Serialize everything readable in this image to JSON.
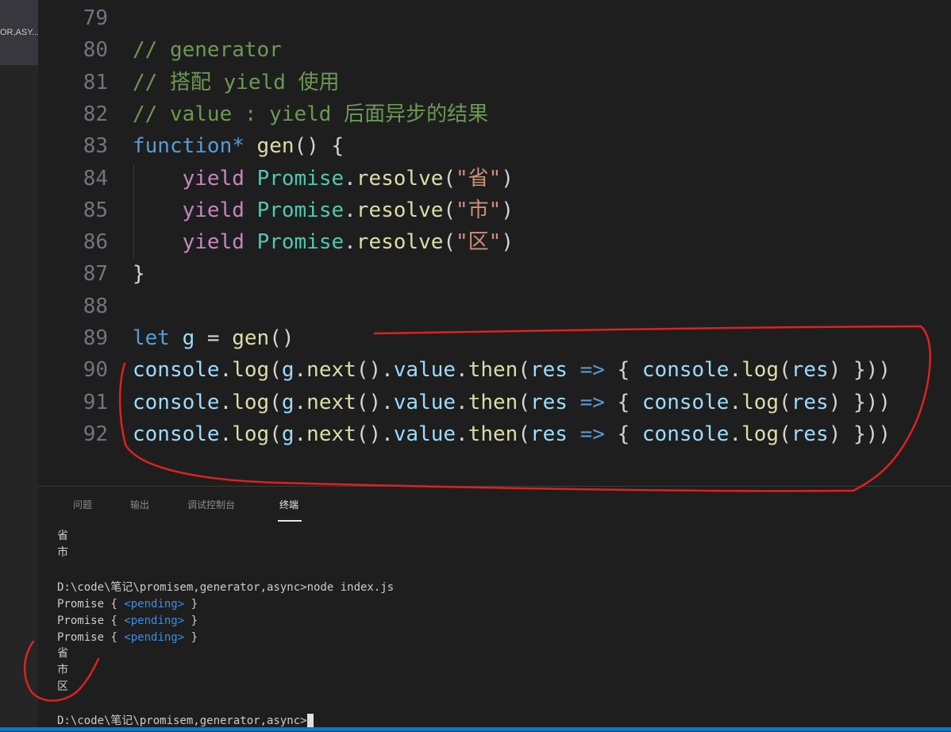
{
  "sidebar": {
    "tab_label": "OR,ASY..."
  },
  "editor": {
    "lines": [
      {
        "num": "79",
        "tokens": []
      },
      {
        "num": "80",
        "tokens": [
          {
            "t": "// generator",
            "c": "cm"
          }
        ]
      },
      {
        "num": "81",
        "tokens": [
          {
            "t": "// 搭配 yield 使用",
            "c": "cm"
          }
        ]
      },
      {
        "num": "82",
        "tokens": [
          {
            "t": "// value : yield 后面异步的结果",
            "c": "cm"
          }
        ]
      },
      {
        "num": "83",
        "tokens": [
          {
            "t": "function*",
            "c": "kw"
          },
          {
            "t": " ",
            "c": "pun"
          },
          {
            "t": "gen",
            "c": "fn"
          },
          {
            "t": "() {",
            "c": "pun"
          }
        ]
      },
      {
        "num": "84",
        "tokens": [
          {
            "t": "    ",
            "c": "pun"
          },
          {
            "t": "yield",
            "c": "yk"
          },
          {
            "t": " ",
            "c": "pun"
          },
          {
            "t": "Promise",
            "c": "cls"
          },
          {
            "t": ".",
            "c": "pun"
          },
          {
            "t": "resolve",
            "c": "fn"
          },
          {
            "t": "(",
            "c": "pun"
          },
          {
            "t": "\"省\"",
            "c": "str"
          },
          {
            "t": ")",
            "c": "pun"
          }
        ]
      },
      {
        "num": "85",
        "tokens": [
          {
            "t": "    ",
            "c": "pun"
          },
          {
            "t": "yield",
            "c": "yk"
          },
          {
            "t": " ",
            "c": "pun"
          },
          {
            "t": "Promise",
            "c": "cls"
          },
          {
            "t": ".",
            "c": "pun"
          },
          {
            "t": "resolve",
            "c": "fn"
          },
          {
            "t": "(",
            "c": "pun"
          },
          {
            "t": "\"市\"",
            "c": "str"
          },
          {
            "t": ")",
            "c": "pun"
          }
        ]
      },
      {
        "num": "86",
        "tokens": [
          {
            "t": "    ",
            "c": "pun"
          },
          {
            "t": "yield",
            "c": "yk"
          },
          {
            "t": " ",
            "c": "pun"
          },
          {
            "t": "Promise",
            "c": "cls"
          },
          {
            "t": ".",
            "c": "pun"
          },
          {
            "t": "resolve",
            "c": "fn"
          },
          {
            "t": "(",
            "c": "pun"
          },
          {
            "t": "\"区\"",
            "c": "str"
          },
          {
            "t": ")",
            "c": "pun"
          }
        ]
      },
      {
        "num": "87",
        "tokens": [
          {
            "t": "}",
            "c": "pun"
          }
        ]
      },
      {
        "num": "88",
        "tokens": []
      },
      {
        "num": "89",
        "tokens": [
          {
            "t": "let",
            "c": "kw"
          },
          {
            "t": " ",
            "c": "pun"
          },
          {
            "t": "g",
            "c": "var"
          },
          {
            "t": " = ",
            "c": "pun"
          },
          {
            "t": "gen",
            "c": "fn"
          },
          {
            "t": "()",
            "c": "pun"
          }
        ]
      },
      {
        "num": "90",
        "tokens": [
          {
            "t": "console",
            "c": "var"
          },
          {
            "t": ".",
            "c": "pun"
          },
          {
            "t": "log",
            "c": "fn"
          },
          {
            "t": "(",
            "c": "pun"
          },
          {
            "t": "g",
            "c": "var"
          },
          {
            "t": ".",
            "c": "pun"
          },
          {
            "t": "next",
            "c": "fn"
          },
          {
            "t": "().",
            "c": "pun"
          },
          {
            "t": "value",
            "c": "var"
          },
          {
            "t": ".",
            "c": "pun"
          },
          {
            "t": "then",
            "c": "fn"
          },
          {
            "t": "(",
            "c": "pun"
          },
          {
            "t": "res",
            "c": "var"
          },
          {
            "t": " ",
            "c": "pun"
          },
          {
            "t": "=>",
            "c": "kw"
          },
          {
            "t": " { ",
            "c": "pun"
          },
          {
            "t": "console",
            "c": "var"
          },
          {
            "t": ".",
            "c": "pun"
          },
          {
            "t": "log",
            "c": "fn"
          },
          {
            "t": "(",
            "c": "pun"
          },
          {
            "t": "res",
            "c": "var"
          },
          {
            "t": ") }))",
            "c": "pun"
          }
        ]
      },
      {
        "num": "91",
        "tokens": [
          {
            "t": "console",
            "c": "var"
          },
          {
            "t": ".",
            "c": "pun"
          },
          {
            "t": "log",
            "c": "fn"
          },
          {
            "t": "(",
            "c": "pun"
          },
          {
            "t": "g",
            "c": "var"
          },
          {
            "t": ".",
            "c": "pun"
          },
          {
            "t": "next",
            "c": "fn"
          },
          {
            "t": "().",
            "c": "pun"
          },
          {
            "t": "value",
            "c": "var"
          },
          {
            "t": ".",
            "c": "pun"
          },
          {
            "t": "then",
            "c": "fn"
          },
          {
            "t": "(",
            "c": "pun"
          },
          {
            "t": "res",
            "c": "var"
          },
          {
            "t": " ",
            "c": "pun"
          },
          {
            "t": "=>",
            "c": "kw"
          },
          {
            "t": " { ",
            "c": "pun"
          },
          {
            "t": "console",
            "c": "var"
          },
          {
            "t": ".",
            "c": "pun"
          },
          {
            "t": "log",
            "c": "fn"
          },
          {
            "t": "(",
            "c": "pun"
          },
          {
            "t": "res",
            "c": "var"
          },
          {
            "t": ") }))",
            "c": "pun"
          }
        ]
      },
      {
        "num": "92",
        "tokens": [
          {
            "t": "console",
            "c": "var"
          },
          {
            "t": ".",
            "c": "pun"
          },
          {
            "t": "log",
            "c": "fn"
          },
          {
            "t": "(",
            "c": "pun"
          },
          {
            "t": "g",
            "c": "var"
          },
          {
            "t": ".",
            "c": "pun"
          },
          {
            "t": "next",
            "c": "fn"
          },
          {
            "t": "().",
            "c": "pun"
          },
          {
            "t": "value",
            "c": "var"
          },
          {
            "t": ".",
            "c": "pun"
          },
          {
            "t": "then",
            "c": "fn"
          },
          {
            "t": "(",
            "c": "pun"
          },
          {
            "t": "res",
            "c": "var"
          },
          {
            "t": " ",
            "c": "pun"
          },
          {
            "t": "=>",
            "c": "kw"
          },
          {
            "t": " { ",
            "c": "pun"
          },
          {
            "t": "console",
            "c": "var"
          },
          {
            "t": ".",
            "c": "pun"
          },
          {
            "t": "log",
            "c": "fn"
          },
          {
            "t": "(",
            "c": "pun"
          },
          {
            "t": "res",
            "c": "var"
          },
          {
            "t": ") }))",
            "c": "pun"
          }
        ]
      }
    ]
  },
  "panel": {
    "tabs": [
      {
        "label": "问题",
        "active": false
      },
      {
        "label": "输出",
        "active": false
      },
      {
        "label": "调试控制台",
        "active": false
      },
      {
        "label": "终端",
        "active": true
      }
    ],
    "terminal": {
      "out1": "省",
      "out2": "市",
      "cmd_prompt": "D:\\code\\笔记\\promisem,generator,async>",
      "cmd": "node index.js",
      "promise_prefix": "Promise { ",
      "pending": "<pending>",
      "promise_suffix": " }",
      "res1": "省",
      "res2": "市",
      "res3": "区",
      "final_prompt": "D:\\code\\笔记\\promisem,generator,async>"
    }
  },
  "colors": {
    "background": "#1e1e1e",
    "comment": "#6a9955",
    "keyword": "#569cd6",
    "control_keyword": "#c586c0",
    "function": "#dcdcaa",
    "class": "#4ec9b0",
    "string": "#ce9178",
    "variable": "#9cdcfe",
    "annotation": "#e02020"
  }
}
